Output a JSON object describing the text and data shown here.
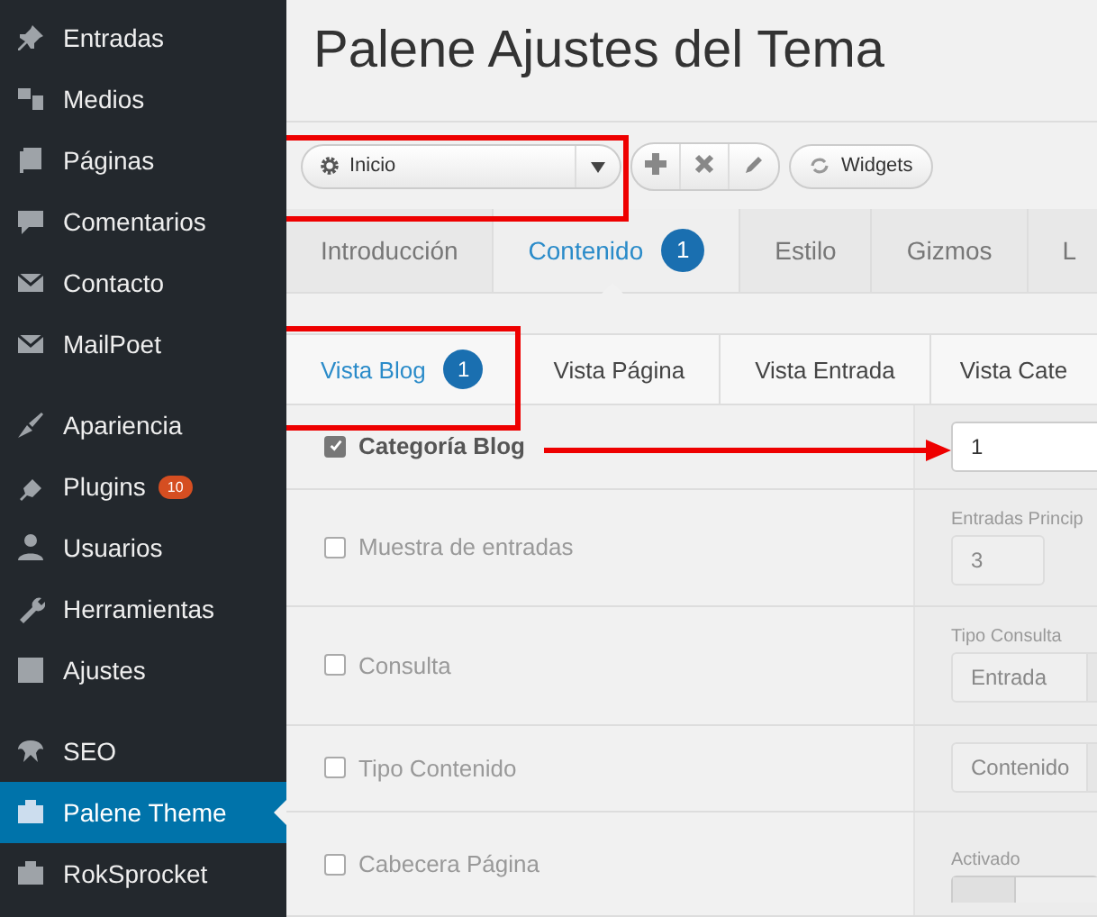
{
  "sidebar": {
    "groups": [
      [
        {
          "label": "Entradas",
          "selected": false
        },
        {
          "label": "Medios",
          "selected": false
        },
        {
          "label": "Páginas",
          "selected": false
        },
        {
          "label": "Comentarios",
          "selected": false
        },
        {
          "label": "Contacto",
          "selected": false
        },
        {
          "label": "MailPoet",
          "selected": false
        }
      ],
      [
        {
          "label": "Apariencia",
          "selected": false
        },
        {
          "label": "Plugins",
          "badge": "10",
          "selected": false
        },
        {
          "label": "Usuarios",
          "selected": false
        },
        {
          "label": "Herramientas",
          "selected": false
        },
        {
          "label": "Ajustes",
          "selected": false
        }
      ],
      [
        {
          "label": "SEO",
          "selected": false
        },
        {
          "label": "Palene Theme",
          "selected": true
        },
        {
          "label": "RokSprocket",
          "selected": false
        }
      ]
    ]
  },
  "page": {
    "title": "Palene Ajustes del Tema"
  },
  "toolbar": {
    "preset": "Inicio",
    "widgets_button": "Widgets"
  },
  "tabs": [
    {
      "label": "Introducción",
      "selected": false
    },
    {
      "label": "Contenido",
      "badge": "1",
      "selected": true
    },
    {
      "label": "Estilo",
      "selected": false
    },
    {
      "label": "Gizmos",
      "selected": false
    },
    {
      "label": "L",
      "selected": false
    }
  ],
  "subtabs": [
    {
      "label": "Vista Blog",
      "badge": "1",
      "selected": true
    },
    {
      "label": "Vista Página",
      "selected": false
    },
    {
      "label": "Vista Entrada",
      "selected": false
    },
    {
      "label": "Vista Cate",
      "selected": false
    }
  ],
  "rows": [
    {
      "label": "Categoría Blog",
      "checked": true,
      "field": {
        "kind": "input",
        "value": "1"
      }
    },
    {
      "label": "Muestra de entradas",
      "checked": false,
      "field": {
        "kind": "input",
        "caption": "Entradas Princip",
        "value": "3"
      }
    },
    {
      "label": "Consulta",
      "checked": false,
      "field": {
        "kind": "select",
        "caption": "Tipo Consulta",
        "value": "Entrada"
      }
    },
    {
      "label": "Tipo Contenido",
      "checked": false,
      "field": {
        "kind": "select",
        "value": "Contenido"
      }
    },
    {
      "label": "Cabecera Página",
      "checked": false,
      "field": {
        "kind": "toggle",
        "caption": "Activado",
        "on": false
      }
    }
  ]
}
